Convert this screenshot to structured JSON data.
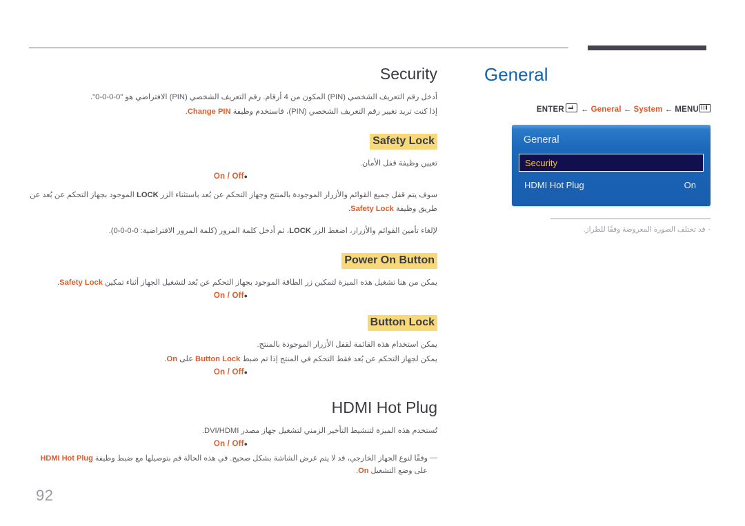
{
  "page": {
    "number": "92"
  },
  "left": {
    "security": {
      "title": "Security",
      "paragraphs": [
        "أدخل رقم التعريف الشخصي (PIN) المكون من 4 أرقام. رقم التعريف الشخصي (PIN) الافتراضي هو \"0-0-0-0\".",
        "إذا كنت تريد تغيير رقم التعريف الشخصي (PIN)، فاستخدم وظيفة Change PIN."
      ],
      "change_pin_keyword": "Change PIN"
    },
    "safety_lock": {
      "heading": "Safety Lock",
      "desc": "تعيين وظيفة قفل الأمان.",
      "options": "On / Off",
      "note1": "سوف يتم قفل جميع القوائم والأزرار الموجودة بالمنتج وجهاز التحكم عن بُعد باستثناء الزر LOCK الموجود بجهاز التحكم عن بُعد عن طريق وظيفة Safety Lock.",
      "note2": "لإلغاء تأمين القوائم والأزرار، اضغط الزر LOCK، ثم أدخل كلمة المرور (كلمة المرور الافتراضية: 0-0-0-0)."
    },
    "power_on_button": {
      "heading": "Power On Button",
      "desc": "يمكن من هنا تشغيل هذه الميزة لتمكين زر الطاقة الموجود بجهاز التحكم عن بُعد لتشغيل الجهاز أثناء تمكين Safety Lock.",
      "options": "On / Off"
    },
    "button_lock": {
      "heading": "Button Lock",
      "desc1": "يمكن استخدام هذه القائمة لقفل الأزرار الموجودة بالمنتج.",
      "desc2": "يمكن لجهاز التحكم عن بُعد فقط التحكم في المنتج إذا تم ضبط Button Lock على On.",
      "options": "On / Off"
    },
    "hdmi_hot_plug": {
      "title": "HDMI Hot Plug",
      "desc": "تُستخدم هذه الميزة لتنشيط التأخير الزمني لتشغيل جهاز مصدر DVI/HDMI.",
      "options": "On / Off",
      "note": "وفقًا لنوع الجهاز الخارجي، قد لا يتم عرض الشاشة بشكل صحيح. في هذه الحالة قم بتوصيلها مع ضبط وظيفة HDMI Hot Plug على وضع التشغيل On."
    }
  },
  "right": {
    "title": "General",
    "breadcrumb": {
      "enter_label": "ENTER",
      "enter_icon": "enter-key-icon",
      "arrow": "←",
      "step_general": "General",
      "step_system": "System",
      "menu_label": "MENU",
      "menu_icon": "menu-grid-icon"
    },
    "osd": {
      "title": "General",
      "rows": [
        {
          "label": "Security",
          "value": "",
          "selected": true
        },
        {
          "label": "HDMI Hot Plug",
          "value": "On",
          "selected": false
        }
      ]
    },
    "note": "قد تختلف الصورة المعروضة وفقًا للطراز.",
    "note_dash": "-"
  },
  "colors": {
    "accent_orange": "#e05a29",
    "heading_highlight": "#f7d97a",
    "title_blue": "#1562ad",
    "osd_blue": "#1d69bb",
    "osd_selected": "#120f4e",
    "osd_selected_text": "#f3c34b",
    "rule_dark": "#46424f"
  }
}
